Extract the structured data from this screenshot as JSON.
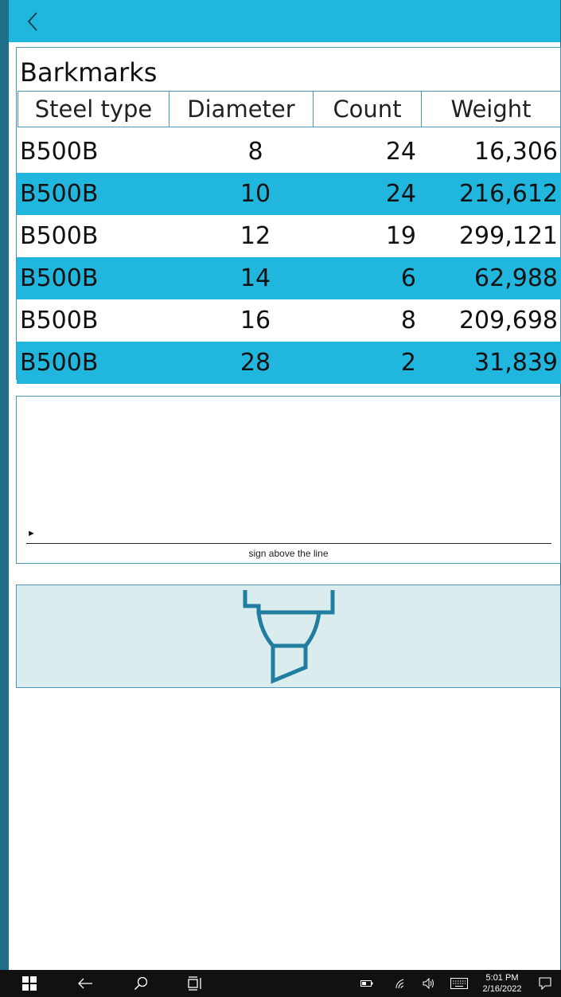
{
  "window": {
    "back_icon": "chevron-left-icon",
    "accent": "#21b6dd"
  },
  "barkmarks": {
    "title": "Barkmarks",
    "columns": [
      "Steel type",
      "Diameter",
      "Count",
      "Weight"
    ],
    "rows": [
      {
        "steel_type": "B500B",
        "diameter": "8",
        "count": "24",
        "weight": "16,306"
      },
      {
        "steel_type": "B500B",
        "diameter": "10",
        "count": "24",
        "weight": "216,612"
      },
      {
        "steel_type": "B500B",
        "diameter": "12",
        "count": "19",
        "weight": "299,121"
      },
      {
        "steel_type": "B500B",
        "diameter": "14",
        "count": "6",
        "weight": "62,988"
      },
      {
        "steel_type": "B500B",
        "diameter": "16",
        "count": "8",
        "weight": "209,698"
      },
      {
        "steel_type": "B500B",
        "diameter": "28",
        "count": "2",
        "weight": "31,839"
      }
    ]
  },
  "signature": {
    "marker": "►",
    "caption": "sign above the line",
    "button_icon": "highlighter-icon"
  },
  "taskbar": {
    "time": "5:01 PM",
    "date": "2/16/2022",
    "icons": [
      "windows-start-icon",
      "back-arrow-icon",
      "search-icon",
      "task-view-icon",
      "battery-icon",
      "wifi-icon",
      "volume-icon",
      "keyboard-icon",
      "notifications-icon"
    ]
  }
}
